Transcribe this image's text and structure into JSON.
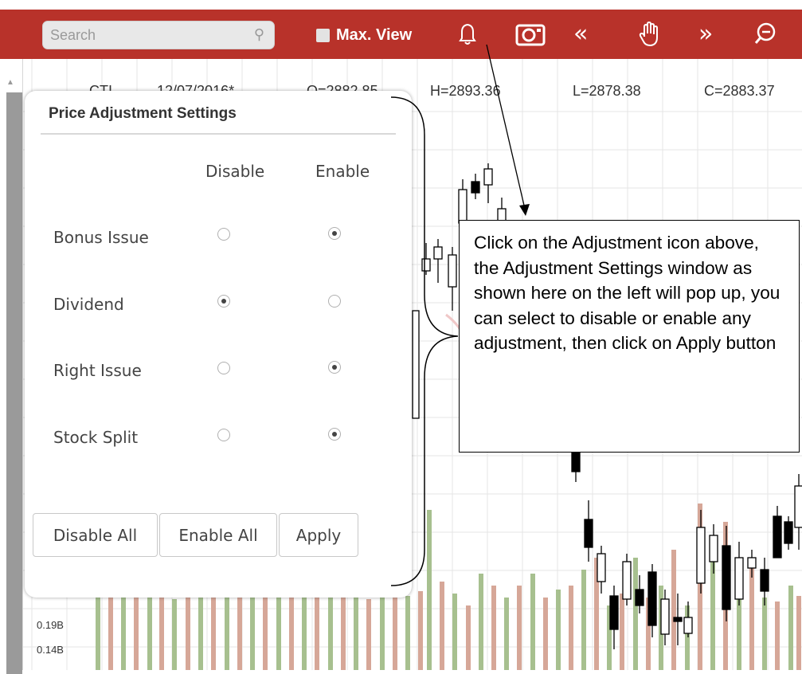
{
  "toolbar": {
    "search_placeholder": "Search",
    "search_icon": "magnifier-icon",
    "max_view_label": "Max. View",
    "icons": [
      "bell-icon",
      "adjustment-icon",
      "double-left-icon",
      "hand-icon",
      "double-right-icon",
      "zoom-out-icon"
    ],
    "background_color": "#b8322a"
  },
  "chart": {
    "ohlc": {
      "symbol": "CTI",
      "date": "12/07/2016*",
      "open": "O=2882.85",
      "high": "H=2893.36",
      "low": "L=2878.38",
      "close": "C=2883.37"
    },
    "volume_ticks": [
      "0.19B",
      "0.14B"
    ],
    "colors": {
      "up_volume": "#a7c08f",
      "down_volume": "#d6a798"
    }
  },
  "dialog": {
    "title": "Price Adjustment Settings",
    "col_disable": "Disable",
    "col_enable": "Enable",
    "rows": [
      {
        "label": "Bonus Issue",
        "selected": "Enable"
      },
      {
        "label": "Dividend",
        "selected": "Disable"
      },
      {
        "label": "Right Issue",
        "selected": "Enable"
      },
      {
        "label": "Stock Split",
        "selected": "Enable"
      }
    ],
    "btn_disable_all": "Disable All",
    "btn_enable_all": "Enable All",
    "btn_apply": "Apply"
  },
  "callout": {
    "text": "Click on the Adjustment icon above, the Adjustment Settings window as shown here on the left will pop up, you can select to disable or enable any adjustment, then click on Apply button"
  }
}
